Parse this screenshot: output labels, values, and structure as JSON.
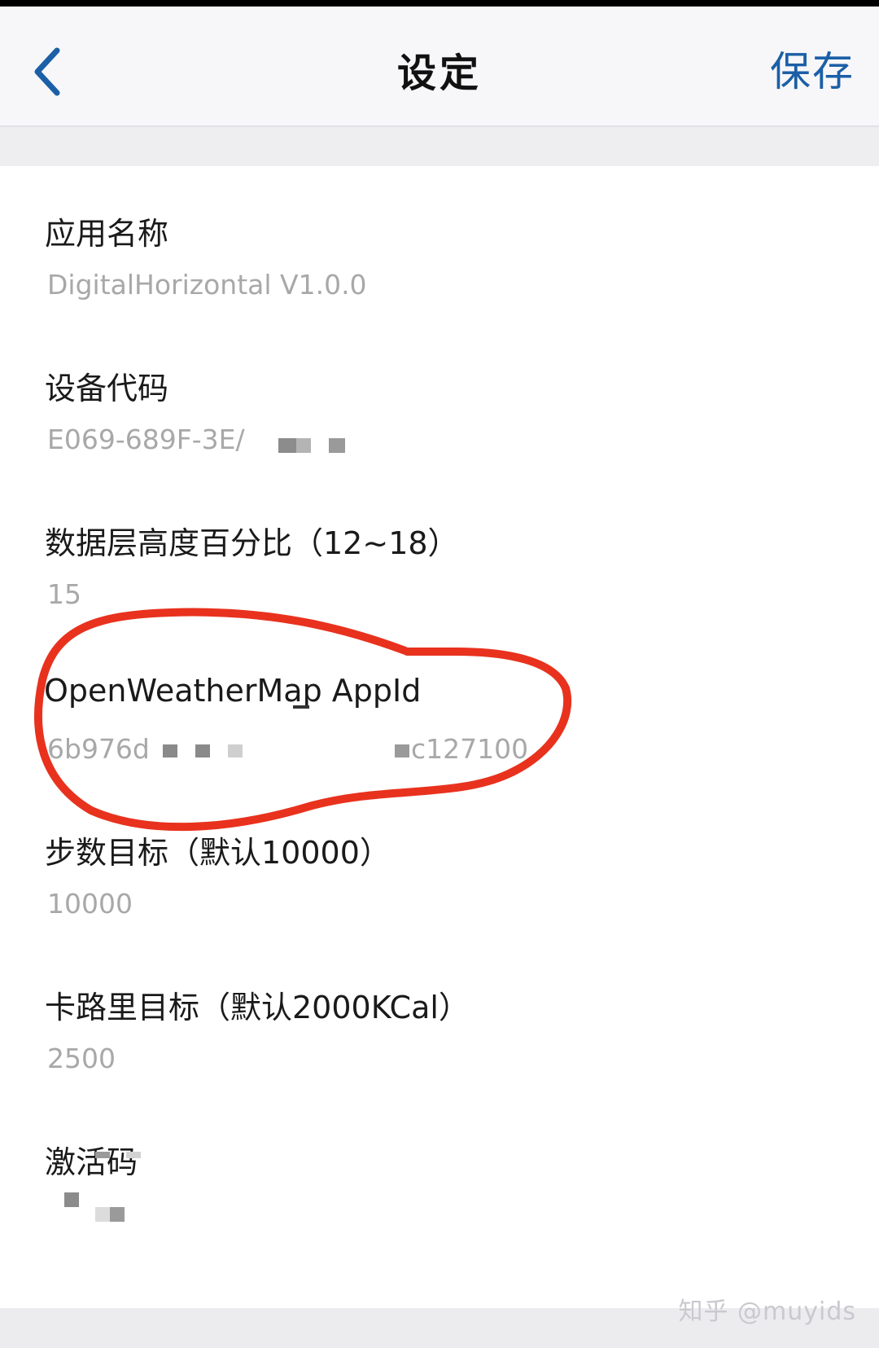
{
  "navbar": {
    "title": "设定",
    "save_label": "保存",
    "back_icon": "chevron-left-icon",
    "accent_color": "#1b5fa6"
  },
  "fields": [
    {
      "label": "应用名称",
      "value": "DigitalHorizontal V1.0.0"
    },
    {
      "label": "设备代码",
      "value": "E069-689F-3E/"
    },
    {
      "label": "数据层高度百分比（12~18）",
      "value": "15"
    },
    {
      "label": "OpenWeatherMap AppId",
      "value": "6b976d",
      "value_tail": "c127100"
    },
    {
      "label": "步数目标（默认10000）",
      "value": "10000"
    },
    {
      "label": "卡路里目标（默认2000KCal）",
      "value": "2500"
    },
    {
      "label": "激活码",
      "value": ""
    }
  ],
  "watermark": "知乎 @muyids",
  "annotation_color": "#e8321e"
}
